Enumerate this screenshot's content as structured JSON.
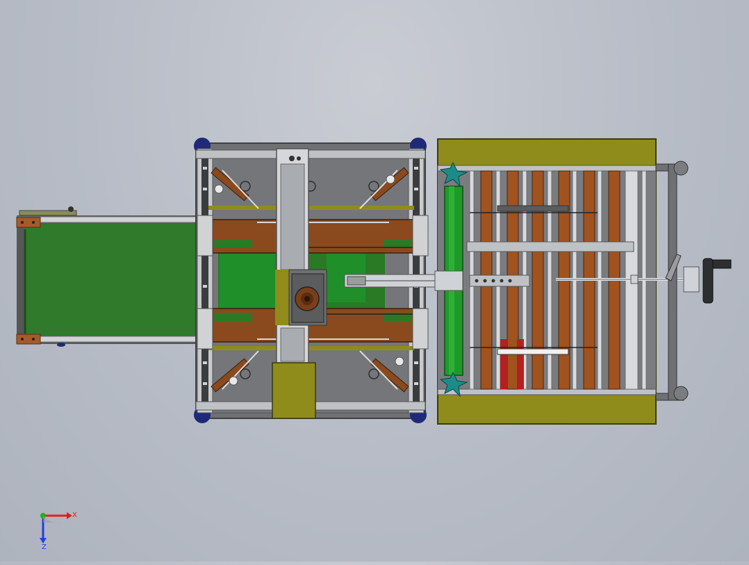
{
  "view": {
    "background_top": "#c9ccd3",
    "background_bottom": "#aeb3bd"
  },
  "colors": {
    "frame_gray": "#6e7073",
    "frame_dark": "#3f4143",
    "conveyor_green": "#2f7a2b",
    "belt_green": "#1f8f2a",
    "wood_brown": "#8a4a1e",
    "roller_copper": "#a0521f",
    "olive_yellow": "#8f8c1c",
    "steel_light": "#cfd2d6",
    "wheel_blue": "#1e2a78",
    "teal_knob": "#1b8c88",
    "red_part": "#b42020"
  },
  "triad": {
    "x_label": "X",
    "z_label": "Z",
    "x_color": "#e02020",
    "y_color": "#20b020",
    "z_color": "#2040e0"
  }
}
